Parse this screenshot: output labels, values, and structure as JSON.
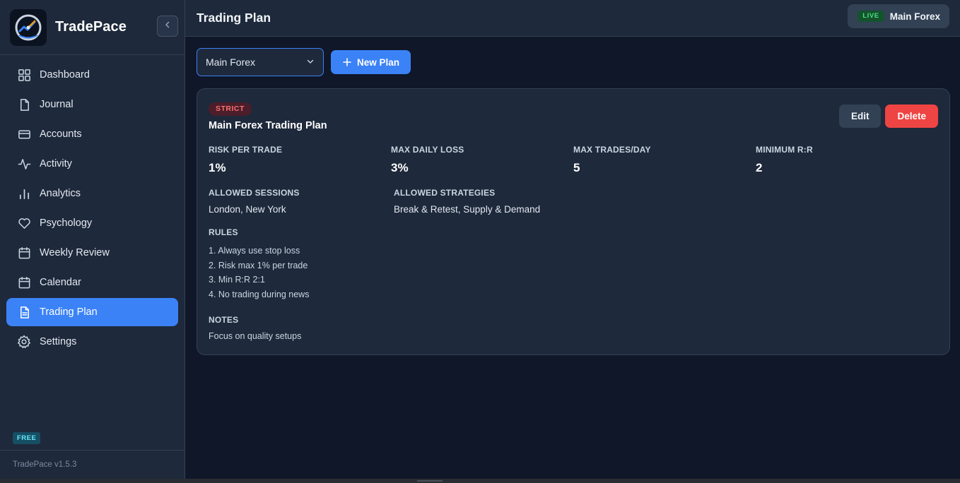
{
  "app": {
    "brand": "TradePace",
    "plan_tier": "FREE",
    "version": "TradePace v1.5.3"
  },
  "sidebar": {
    "items": [
      {
        "label": "Dashboard",
        "icon": "grid-icon"
      },
      {
        "label": "Journal",
        "icon": "document-icon"
      },
      {
        "label": "Accounts",
        "icon": "credit-card-icon"
      },
      {
        "label": "Activity",
        "icon": "activity-icon"
      },
      {
        "label": "Analytics",
        "icon": "bar-chart-icon"
      },
      {
        "label": "Psychology",
        "icon": "heart-icon"
      },
      {
        "label": "Weekly Review",
        "icon": "calendar-icon"
      },
      {
        "label": "Calendar",
        "icon": "calendar-icon"
      },
      {
        "label": "Trading Plan",
        "icon": "file-text-icon",
        "active": true
      },
      {
        "label": "Settings",
        "icon": "gear-icon"
      }
    ]
  },
  "header": {
    "title": "Trading Plan",
    "account_status": "LIVE",
    "account_name": "Main Forex"
  },
  "toolbar": {
    "selected_plan": "Main Forex",
    "new_plan_label": "New Plan"
  },
  "plan": {
    "badge": "STRICT",
    "name": "Main Forex Trading Plan",
    "edit_label": "Edit",
    "delete_label": "Delete",
    "stats": [
      {
        "label": "RISK PER TRADE",
        "value": "1%"
      },
      {
        "label": "MAX DAILY LOSS",
        "value": "3%"
      },
      {
        "label": "MAX TRADES/DAY",
        "value": "5"
      },
      {
        "label": "MINIMUM R:R",
        "value": "2"
      }
    ],
    "sessions_label": "ALLOWED SESSIONS",
    "sessions": "London, New York",
    "strategies_label": "ALLOWED STRATEGIES",
    "strategies": "Break & Retest, Supply & Demand",
    "rules_label": "RULES",
    "rules": [
      "1. Always use stop loss",
      "2. Risk max 1% per trade",
      "3. Min R:R 2:1",
      "4. No trading during news"
    ],
    "notes_label": "NOTES",
    "notes": "Focus on quality setups"
  },
  "colors": {
    "accent": "#3b82f6",
    "danger": "#ef4444",
    "live": "#4ade80",
    "background": "#0f1729",
    "panel": "#1e293b"
  }
}
